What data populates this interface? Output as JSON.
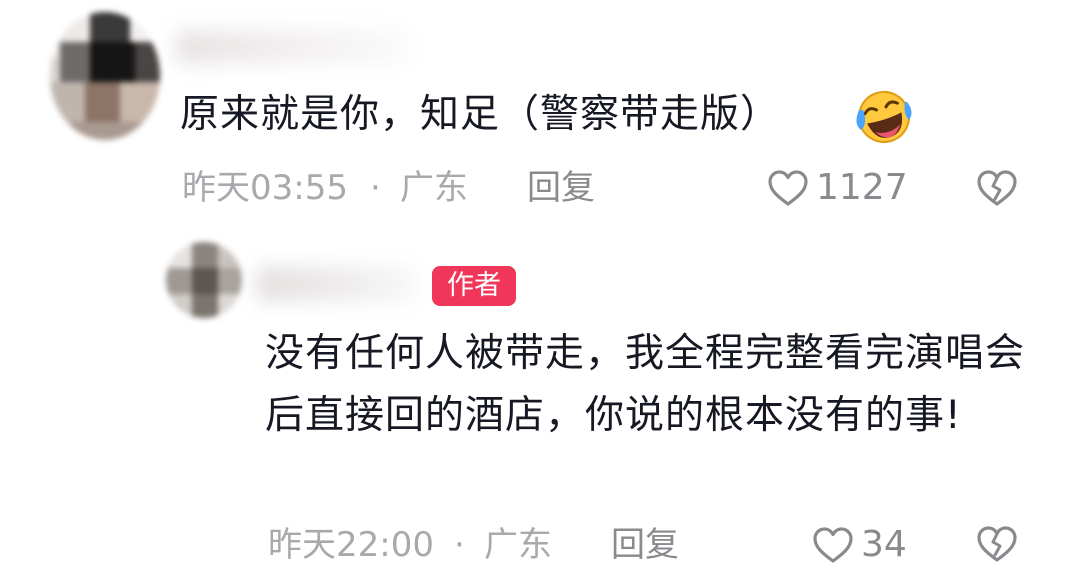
{
  "comment": {
    "text": "原来就是你，知足（警察带走版）",
    "emoji": "laughing-crying-emoji",
    "time": "昨天03:55",
    "separator": "·",
    "region": "广东",
    "reply_label": "回复",
    "likes": "1127"
  },
  "reply": {
    "badge": "作者",
    "text": "没有任何人被带走，我全程完整看完演唱会后直接回的酒店，你说的根本没有的事!",
    "time": "昨天22:00",
    "separator": "·",
    "region": "广东",
    "reply_label": "回复",
    "likes": "34"
  },
  "icons": {
    "like": "heart-outline-icon",
    "dislike": "broken-heart-icon"
  },
  "colors": {
    "text": "#161823",
    "meta": "#a9a9ad",
    "badge": "#f0375a",
    "background": "#ffffff"
  }
}
